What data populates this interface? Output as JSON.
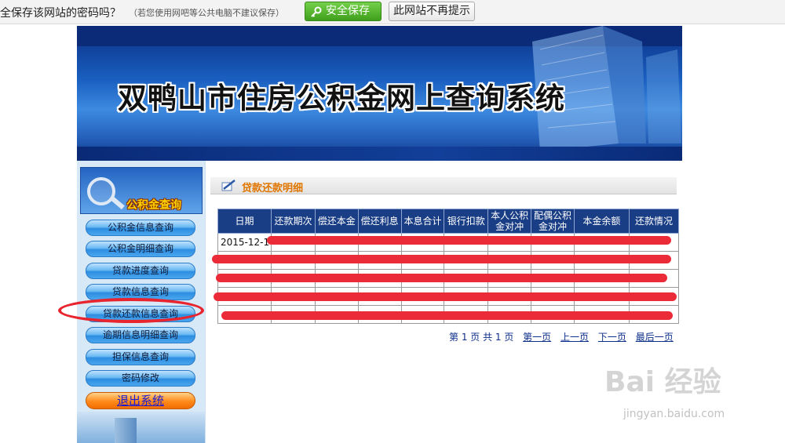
{
  "password_bar": {
    "question": "全保存该网站的密码吗？",
    "hint": "（若您使用网吧等公共电脑不建议保存）",
    "save_label": "安全保存",
    "never_label": "此网站不再提示"
  },
  "site": {
    "title": "双鸭山市住房公积金网上查询系统",
    "sidebar_heading": "公积金查询",
    "nav": [
      "公积金信息查询",
      "公积金明细查询",
      "贷款进度查询",
      "贷款信息查询",
      "贷款还款信息查询",
      "逾期信息明细查询",
      "担保信息查询",
      "密码修改"
    ],
    "exit_label": "退出系统"
  },
  "section_title": "贷款还款明细",
  "table": {
    "headers": [
      "日期",
      "还款期次",
      "偿还本金",
      "偿还利息",
      "本息合计",
      "银行扣款",
      "本人公积\n金对冲",
      "配偶公积\n金对冲",
      "本金余额",
      "还款情况"
    ],
    "rows": [
      [
        "2015-12-17",
        "",
        "",
        "",
        "",
        "",
        "",
        "",
        "",
        ""
      ],
      [
        "",
        "",
        "",
        "",
        "",
        "",
        "",
        "",
        "",
        ""
      ],
      [
        "",
        "",
        "",
        "",
        "",
        "",
        "",
        "",
        "",
        ""
      ],
      [
        "",
        "",
        "",
        "",
        "",
        "",
        "",
        "",
        "",
        ""
      ],
      [
        "",
        "",
        "",
        "",
        "",
        "",
        "",
        "",
        "",
        ""
      ]
    ]
  },
  "pager": {
    "status": "第 1 页 共 1 页",
    "first": "第一页",
    "prev": "上一页",
    "next": "下一页",
    "last": "最后一页"
  },
  "watermark": {
    "brand": "Bai 经验",
    "url": "jingyan.baidu.com"
  },
  "colors": {
    "header_blue": "#1a3e85",
    "save_green": "#4caf2a",
    "annotation_red": "#e8252f",
    "section_orange": "#e07600"
  }
}
